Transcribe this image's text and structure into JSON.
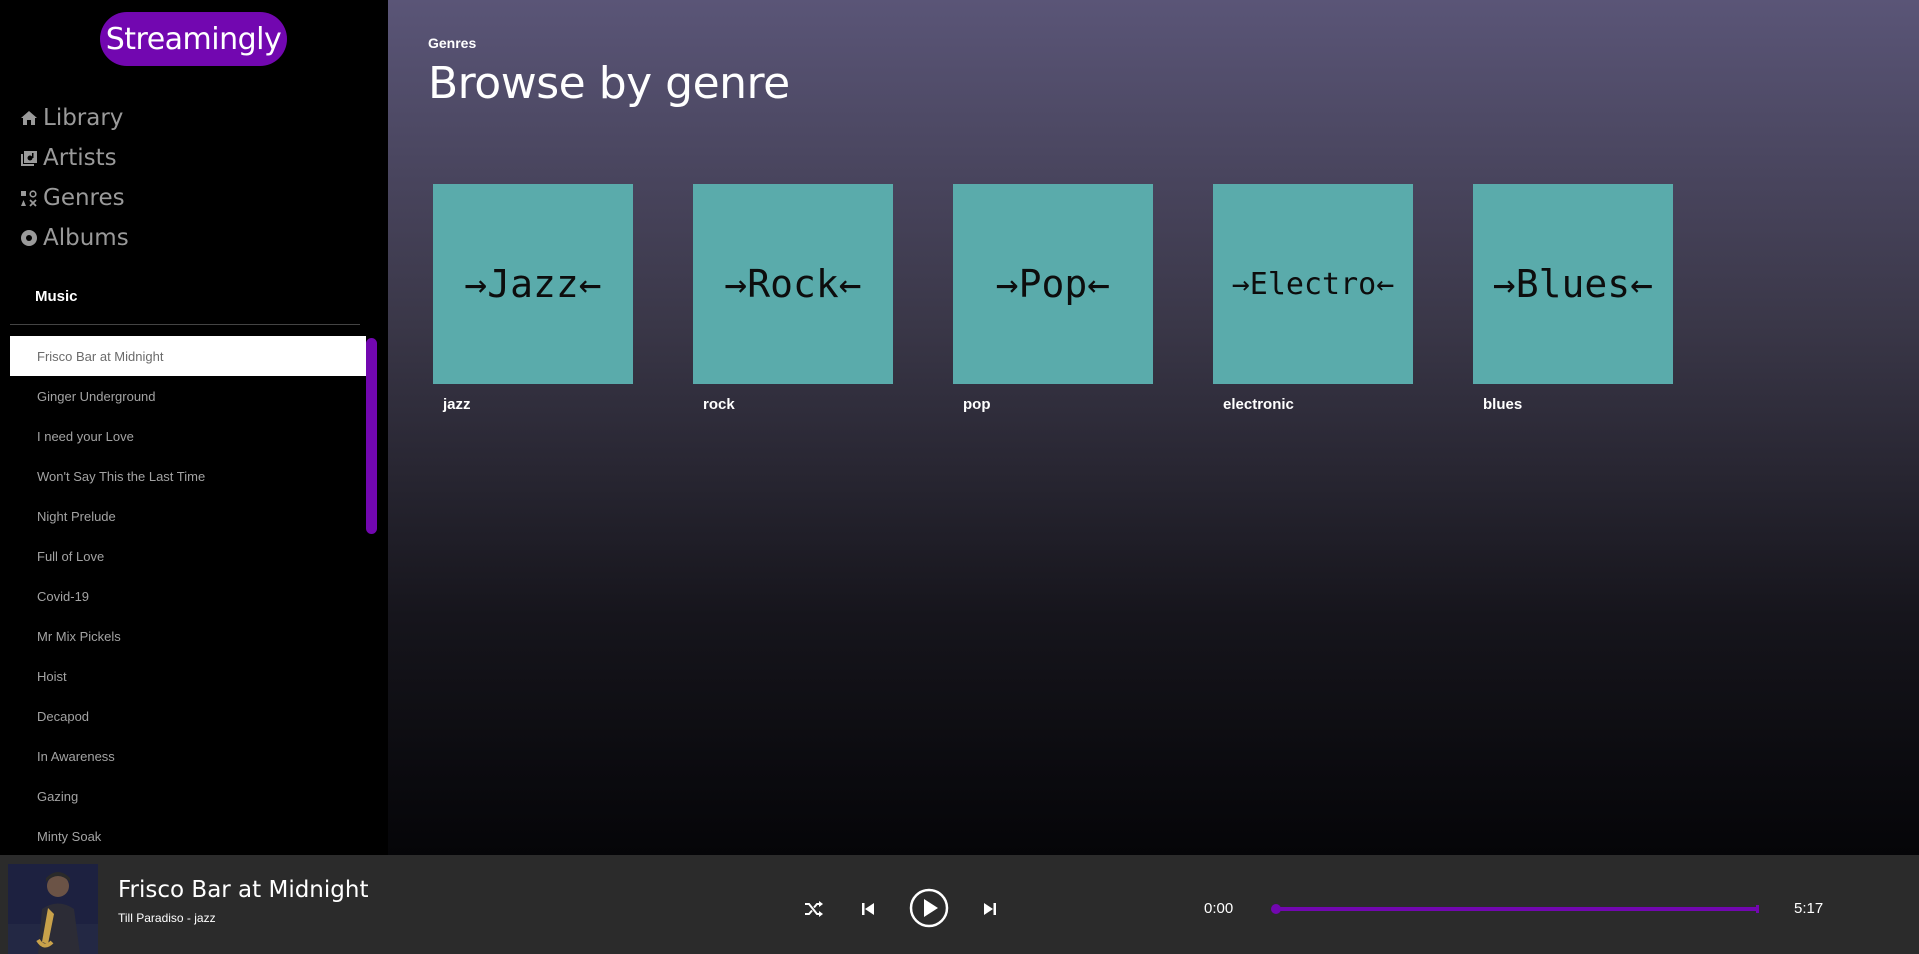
{
  "app": {
    "logo": "Streamingly",
    "accent_color": "#7207b0"
  },
  "nav": [
    {
      "label": "Library",
      "icon": "home-icon"
    },
    {
      "label": "Artists",
      "icon": "artists-icon"
    },
    {
      "label": "Genres",
      "icon": "genres-icon"
    },
    {
      "label": "Albums",
      "icon": "album-icon"
    }
  ],
  "sidebar": {
    "heading": "Music",
    "tracks": [
      "Frisco Bar at Midnight",
      "Ginger Underground",
      "I need your Love",
      "Won't Say This the Last Time",
      "Night Prelude",
      "Full of Love",
      "Covid-19",
      "Mr Mix Pickels",
      "Hoist",
      "Decapod",
      "In Awareness",
      "Gazing",
      "Minty Soak"
    ],
    "active_track_index": 0
  },
  "main": {
    "breadcrumb": "Genres",
    "title": "Browse by genre",
    "genres": [
      {
        "tile_text": "→Jazz←",
        "name": "jazz"
      },
      {
        "tile_text": "→Rock←",
        "name": "rock"
      },
      {
        "tile_text": "→Pop←",
        "name": "pop"
      },
      {
        "tile_text": "→Electro←",
        "name": "electronic"
      },
      {
        "tile_text": "→Blues←",
        "name": "blues"
      }
    ],
    "tile_color": "#5aabab"
  },
  "player": {
    "title": "Frisco Bar at Midnight",
    "subtitle": "Till Paradiso - jazz",
    "time_current": "0:00",
    "time_total": "5:17",
    "progress": 0.0,
    "controls": [
      "shuffle-icon",
      "previous-icon",
      "play-icon",
      "next-icon"
    ]
  }
}
